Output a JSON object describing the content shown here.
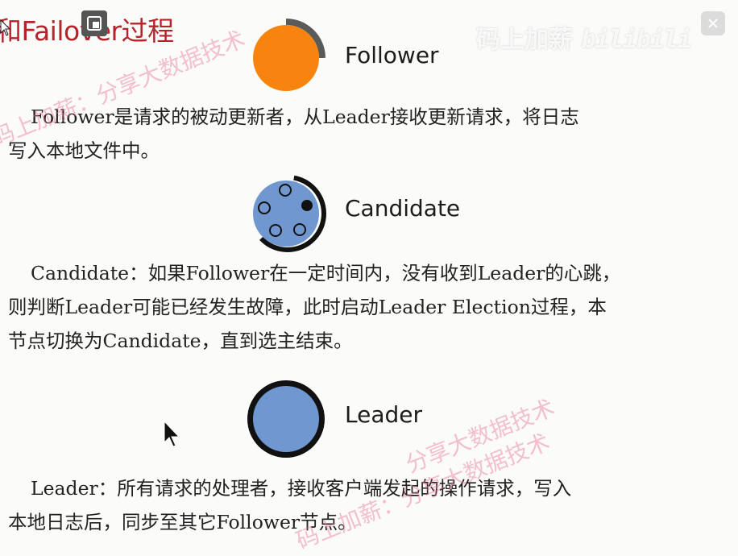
{
  "title": "和Failover过程",
  "roles": {
    "follower": {
      "label": "Follower",
      "paragraph": [
        "Follower是请求的被动更新者，从Leader接收更新请求，将日志",
        "写入本地文件中。"
      ]
    },
    "candidate": {
      "label": "Candidate",
      "paragraph": [
        "Candidate：如果Follower在一定时间内，没有收到Leader的心跳，",
        "则判断Leader可能已经发生故障，此时启动Leader Election过程，本",
        "节点切换为Candidate，直到选主结束。"
      ]
    },
    "leader": {
      "label": "Leader",
      "paragraph": [
        "Leader：所有请求的处理者，接收客户端发起的操作请求，写入",
        "本地日志后，同步至其它Follower节点。"
      ]
    }
  },
  "watermarks": {
    "top": "码上加薪：分享大数据技术",
    "middle": "分享大数据技术",
    "bottom": "码上加薪：分享大数据技术"
  },
  "brand": {
    "text": "码上加薪",
    "logo": "bilibili"
  },
  "icons": {
    "pip": "picture-in-picture-icon",
    "close": "close-icon",
    "cursor": "mouse-cursor-icon"
  },
  "colors": {
    "title": "#b5242b",
    "follower_fill": "#f7840f",
    "node_blue": "#7097cf",
    "ring_dark": "#111111",
    "ring_gray": "#5a5a5a"
  }
}
